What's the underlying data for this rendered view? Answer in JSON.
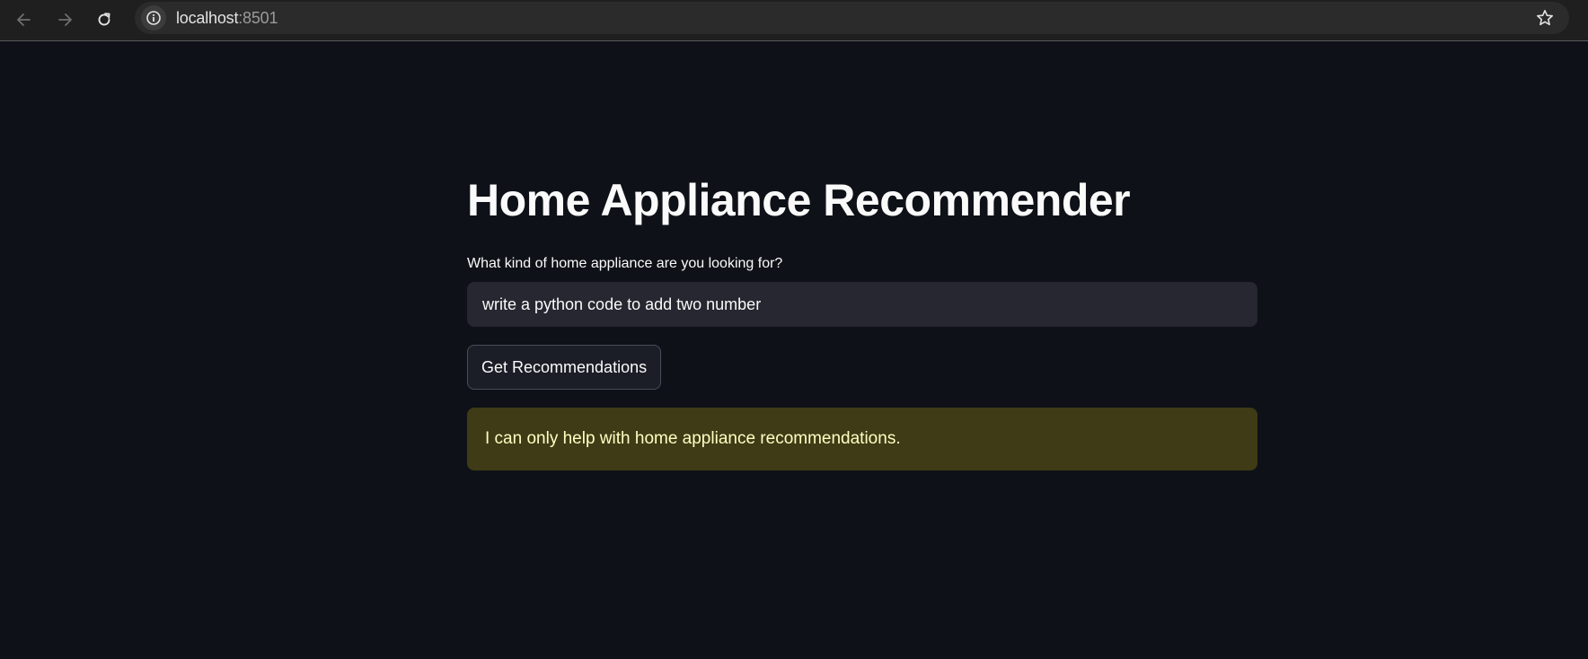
{
  "browser": {
    "url_host": "localhost",
    "url_port": ":8501",
    "icons": [
      "back-arrow-icon",
      "forward-arrow-icon",
      "reload-icon",
      "site-info-icon",
      "bookmark-star-icon"
    ]
  },
  "app": {
    "title": "Home Appliance Recommender",
    "input_label": "What kind of home appliance are you looking for?",
    "input_value": "write a python code to add two number",
    "button_label": "Get Recommendations",
    "warning_message": "I can only help with home appliance recommendations."
  },
  "colors": {
    "background": "#0e1117",
    "input_background": "#262730",
    "warning_background": "#3e3b16",
    "warning_text": "#ffffc2",
    "text": "#fafafa"
  }
}
